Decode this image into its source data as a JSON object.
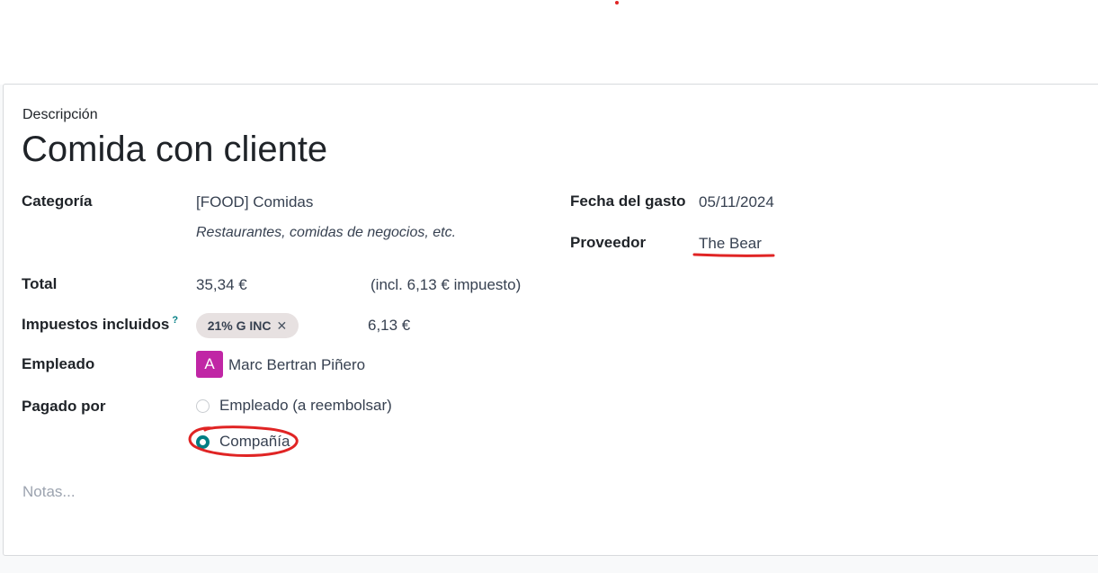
{
  "form": {
    "description_label": "Descripción",
    "title": "Comida con cliente",
    "category": {
      "label": "Categoría",
      "value": "[FOOD] Comidas",
      "note": "Restaurantes, comidas de negocios, etc."
    },
    "expense_date": {
      "label": "Fecha del gasto",
      "value": "05/11/2024"
    },
    "vendor": {
      "label": "Proveedor",
      "value": "The Bear"
    },
    "total": {
      "label": "Total",
      "value": "35,34 €",
      "tax_note": "(incl. 6,13 € impuesto)"
    },
    "taxes": {
      "label": "Impuestos incluidos",
      "help": "?",
      "tag": "21% G INC",
      "tag_remove": "✕",
      "amount": "6,13 €"
    },
    "employee": {
      "label": "Empleado",
      "avatar_initial": "A",
      "avatar_color": "#c026a5",
      "name": "Marc Bertran Piñero"
    },
    "paid_by": {
      "label": "Pagado por",
      "options": [
        {
          "label": "Empleado (a reembolsar)",
          "selected": false
        },
        {
          "label": "Compañía",
          "selected": true
        }
      ]
    },
    "notes_placeholder": "Notas..."
  },
  "colors": {
    "accent": "#017e84",
    "annotation": "#e02424"
  }
}
